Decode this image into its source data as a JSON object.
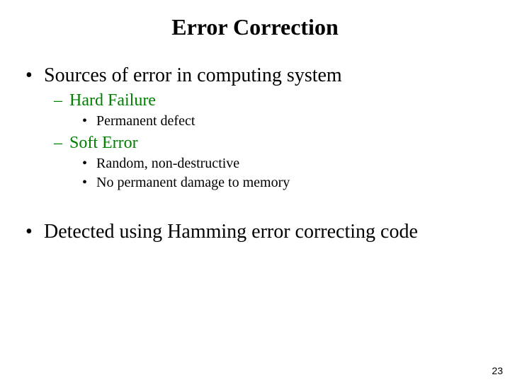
{
  "title": "Error Correction",
  "bullets": {
    "l1a": "Sources of error in computing system",
    "l2a": "Hard Failure",
    "l3a": "Permanent defect",
    "l2b": "Soft Error",
    "l3b": "Random, non-destructive",
    "l3c": "No permanent damage to memory",
    "l1b": "Detected using Hamming error correcting code"
  },
  "page_number": "23"
}
